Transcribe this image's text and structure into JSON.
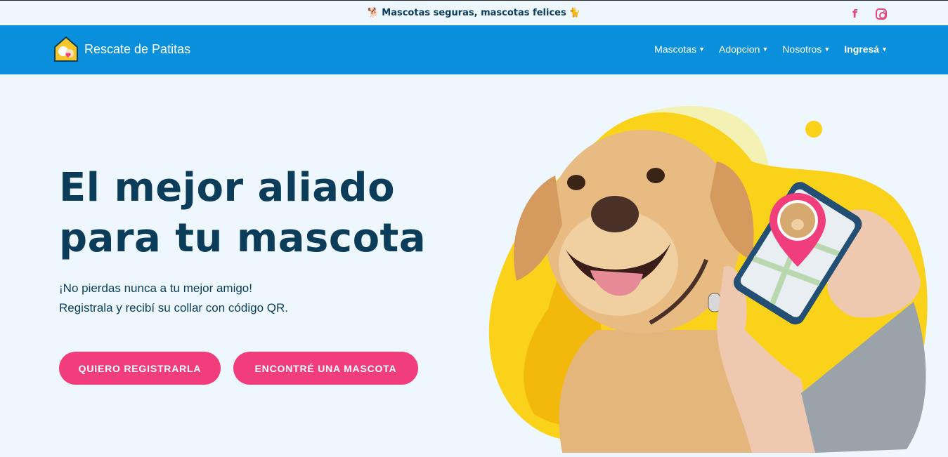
{
  "topbar": {
    "tagline": "Mascotas seguras, mascotas felices",
    "left_icon": "dog-icon",
    "right_icon": "cat-icon",
    "facebook_icon": "facebook-icon",
    "instagram_icon": "instagram-icon"
  },
  "nav": {
    "brand": "Rescate de Patitas",
    "items": [
      {
        "label": "Mascotas"
      },
      {
        "label": "Adopcion"
      },
      {
        "label": "Nosotros"
      },
      {
        "label": "Ingresá"
      }
    ]
  },
  "hero": {
    "title_line1": "El mejor aliado",
    "title_line2": "para tu mascota",
    "subtitle_line1": "¡No pierdas nunca a tu mejor amigo!",
    "subtitle_line2": "Registrala y recibí su collar con código QR.",
    "button_primary": "QUIERO REGISTRARLA",
    "button_secondary": "ENCONTRÉ UNA MASCOTA"
  },
  "colors": {
    "nav_bg": "#0a8fdc",
    "accent": "#f23d7c",
    "text": "#0b3d5a",
    "blob_yellow": "#f7c10f"
  }
}
